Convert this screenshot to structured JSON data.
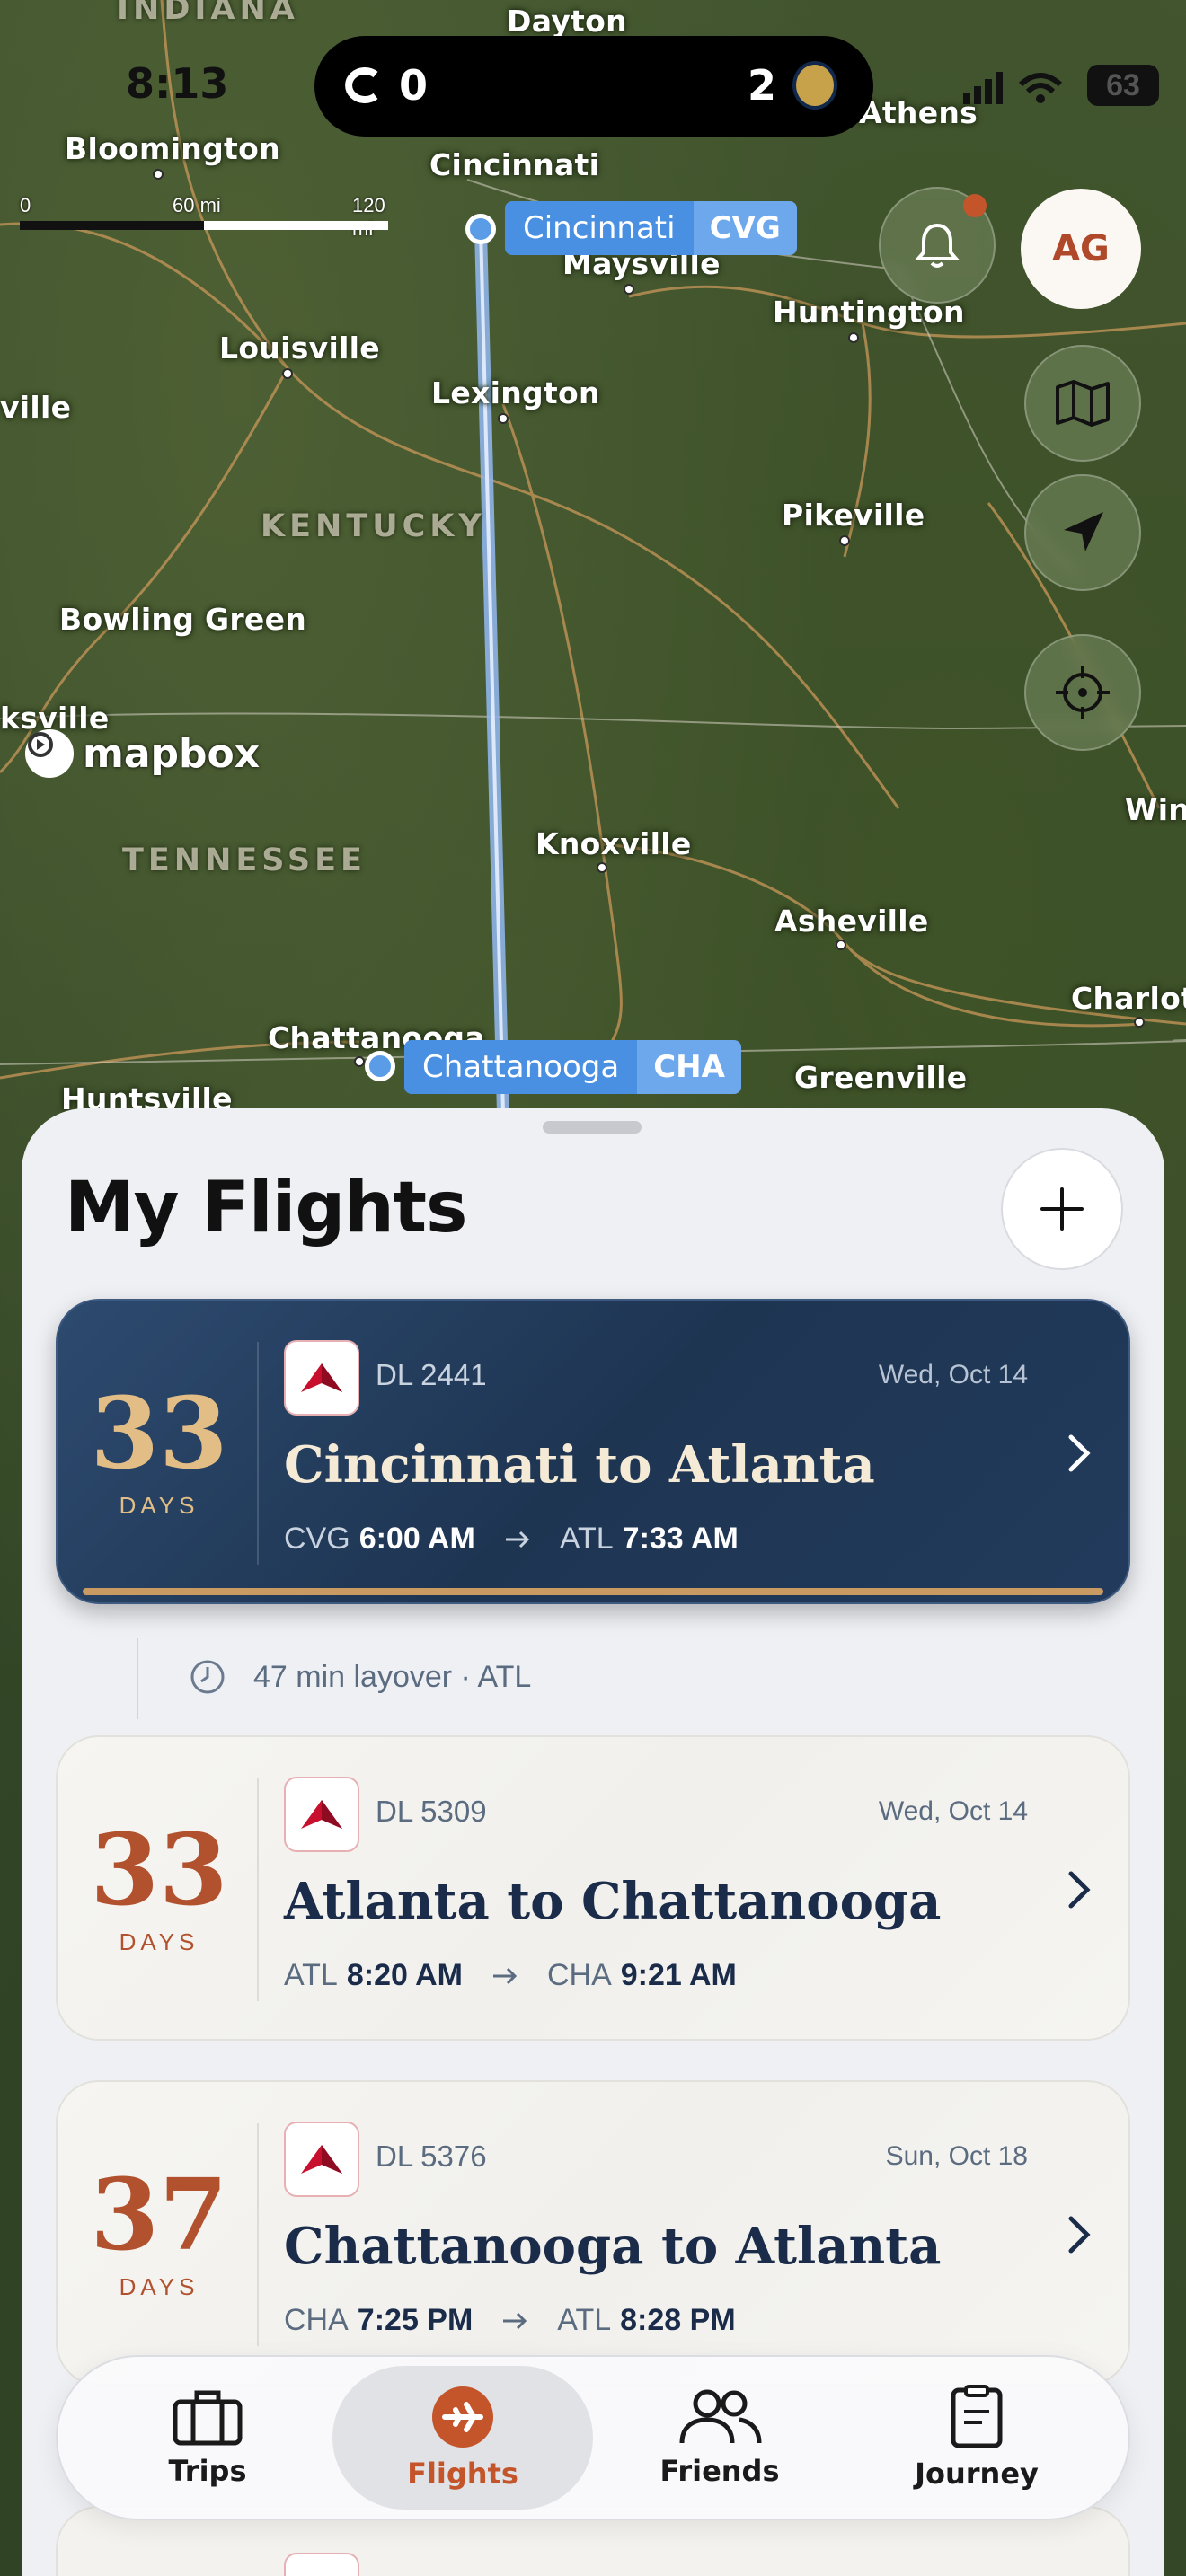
{
  "status_bar": {
    "time": "8:13",
    "left_score": "0",
    "right_score": "2",
    "battery": "63"
  },
  "map": {
    "scale": {
      "zero": "0",
      "mid": "60 mi",
      "max": "120 mi"
    },
    "cities": [
      {
        "name": "Dayton"
      },
      {
        "name": "Athens"
      },
      {
        "name": "Bloomington"
      },
      {
        "name": "Cincinnati"
      },
      {
        "name": "Maysville"
      },
      {
        "name": "Huntington"
      },
      {
        "name": "Louisville"
      },
      {
        "name": "Lexington"
      },
      {
        "name": "ville"
      },
      {
        "name": "Pikeville"
      },
      {
        "name": "Bowling Green"
      },
      {
        "name": "ksville"
      },
      {
        "name": "Knoxville"
      },
      {
        "name": "Win"
      },
      {
        "name": "Asheville"
      },
      {
        "name": "Charlot"
      },
      {
        "name": "Chattanooga"
      },
      {
        "name": "Greenville"
      },
      {
        "name": "Huntsville"
      }
    ],
    "regions": [
      "INDIANA",
      "KENTUCKY",
      "TENNESSEE"
    ],
    "origin": {
      "name": "Cincinnati",
      "code": "CVG"
    },
    "destination": {
      "name": "Chattanooga",
      "code": "CHA"
    },
    "attribution": "mapbox",
    "avatar_initials": "AG",
    "colors": {
      "route": "#8fb4e8",
      "pin": "#5a9ce6",
      "tag": "#4a90e2",
      "tag_code": "#6ea8ec"
    }
  },
  "sheet": {
    "title": "My Flights",
    "flights": [
      {
        "countdown": "33",
        "unit": "DAYS",
        "flight_no": "DL 2441",
        "date": "Wed, Oct 14",
        "route": "Cincinnati to Atlanta",
        "dep_code": "CVG",
        "dep_time": "6:00 AM",
        "arr_code": "ATL",
        "arr_time": "7:33 AM"
      },
      {
        "countdown": "33",
        "unit": "DAYS",
        "flight_no": "DL 5309",
        "date": "Wed, Oct 14",
        "route": "Atlanta to Chattanooga",
        "dep_code": "ATL",
        "dep_time": "8:20 AM",
        "arr_code": "CHA",
        "arr_time": "9:21 AM"
      },
      {
        "countdown": "37",
        "unit": "DAYS",
        "flight_no": "DL 5376",
        "date": "Sun, Oct 18",
        "route": "Chattanooga to Atlanta",
        "dep_code": "CHA",
        "dep_time": "7:25 PM",
        "arr_code": "ATL",
        "arr_time": "8:28 PM"
      }
    ],
    "layover": "47 min layover · ATL"
  },
  "tabbar": {
    "tabs": [
      {
        "label": "Trips",
        "icon": "suitcase-icon"
      },
      {
        "label": "Flights",
        "icon": "airplane-icon",
        "active": true
      },
      {
        "label": "Friends",
        "icon": "people-icon"
      },
      {
        "label": "Journey",
        "icon": "clipboard-icon"
      }
    ],
    "accent": "#c4552b"
  }
}
